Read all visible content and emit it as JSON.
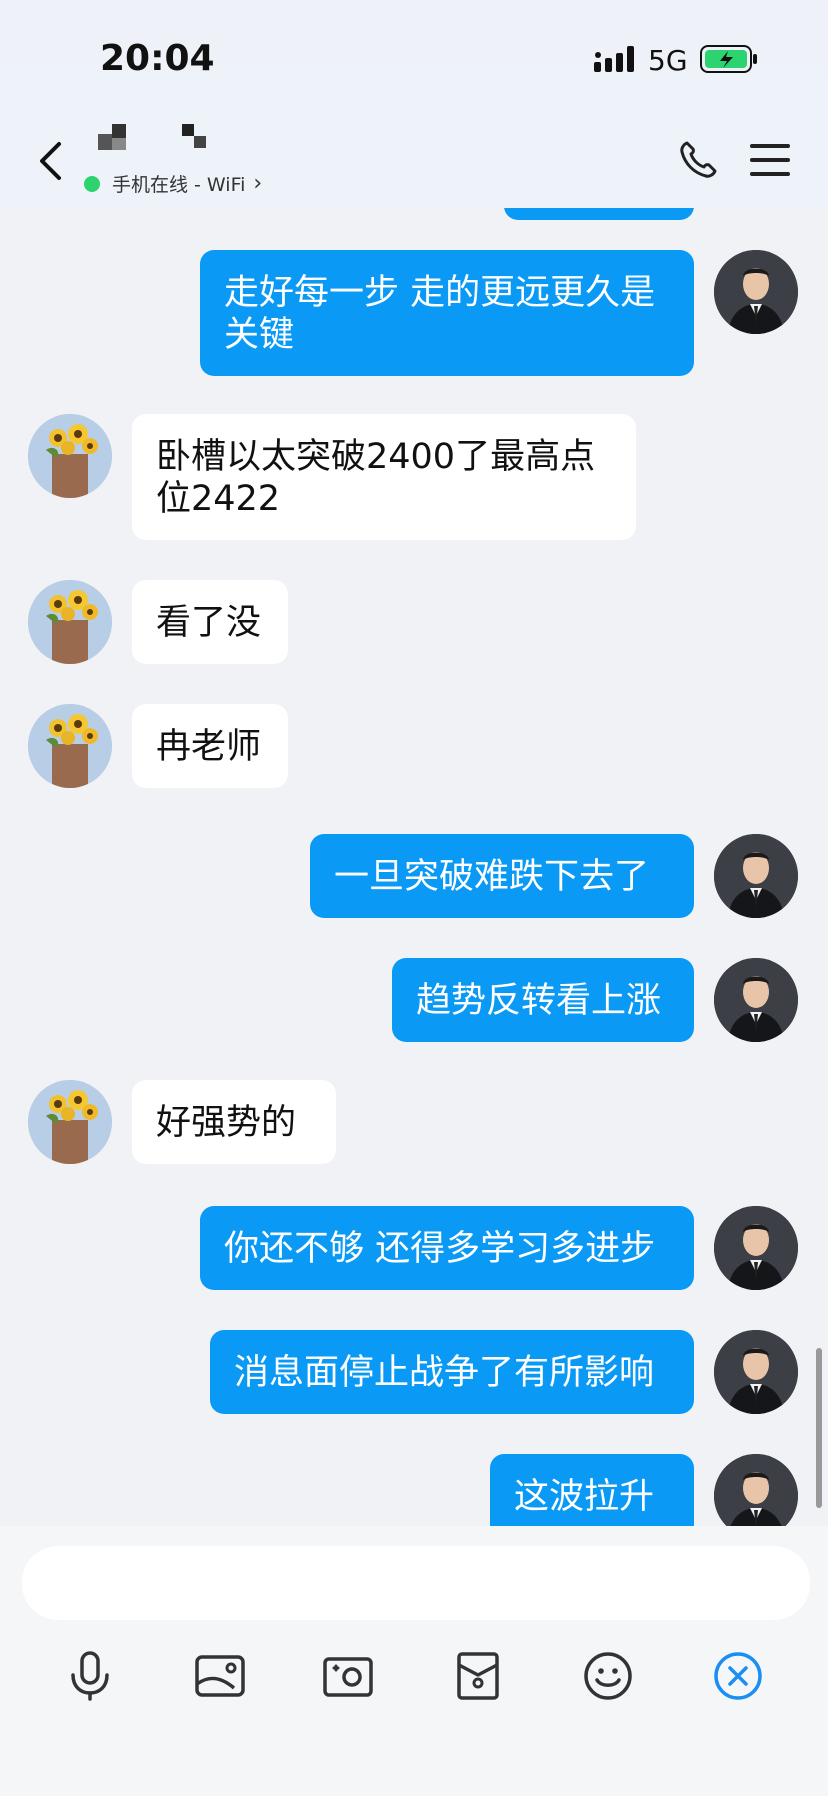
{
  "status": {
    "time": "20:04",
    "network": "5G"
  },
  "header": {
    "online_status": "手机在线 - WiFi"
  },
  "messages": [
    {
      "side": "right",
      "text": "走好每一步 走的更远更久是关键"
    },
    {
      "side": "left",
      "text": "卧槽以太突破2400了最高点位2422"
    },
    {
      "side": "left",
      "text": "看了没"
    },
    {
      "side": "left",
      "text": "冉老师"
    },
    {
      "side": "right",
      "text": "一旦突破难跌下去了"
    },
    {
      "side": "right",
      "text": "趋势反转看上涨"
    },
    {
      "side": "left",
      "text": "好强势的"
    },
    {
      "side": "right",
      "text": "你还不够 还得多学习多进步"
    },
    {
      "side": "right",
      "text": "消息面停止战争了有所影响"
    },
    {
      "side": "right",
      "text": "这波拉升"
    }
  ],
  "composer": {
    "placeholder": ""
  },
  "icons": {
    "back": "chevron-left-icon",
    "call": "phone-icon",
    "menu": "menu-icon",
    "voice": "microphone-icon",
    "image": "image-icon",
    "camera": "camera-icon",
    "file": "document-icon",
    "emoji": "emoji-icon",
    "close": "close-circle-icon"
  },
  "colors": {
    "accent": "#0a9af5",
    "online": "#2dd36f",
    "battery": "#2dd36f"
  }
}
